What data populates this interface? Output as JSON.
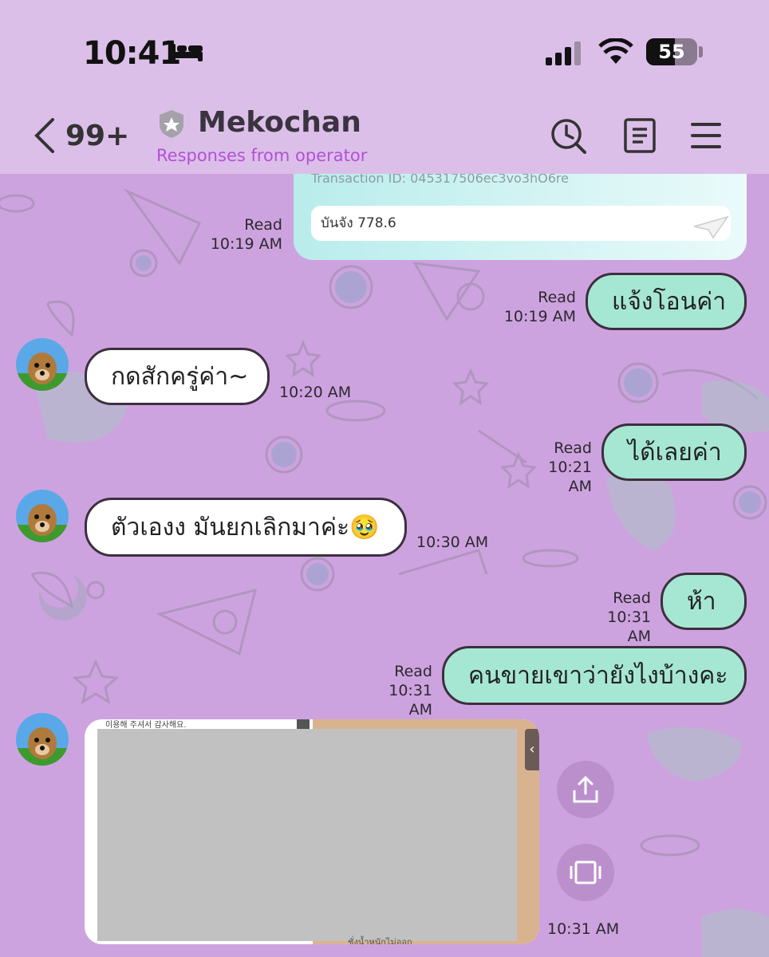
{
  "status_bar": {
    "time": "10:41",
    "battery": "55"
  },
  "header": {
    "back_count": "99+",
    "contact_name": "Mekochan",
    "subtitle": "Responses from operator"
  },
  "transfer": {
    "transaction_id": "Transaction ID: 045317506ec3vo3hO6re",
    "note": "บันจัง 778.6"
  },
  "messages": [
    {
      "side": "out",
      "status": "Read",
      "time": "10:19 AM",
      "text": ""
    },
    {
      "side": "out",
      "status": "Read",
      "time": "10:19 AM",
      "text": "แจ้งโอนค่า"
    },
    {
      "side": "in",
      "time": "10:20 AM",
      "text": "กดสักครู่ค่า~"
    },
    {
      "side": "out",
      "status": "Read",
      "time": "10:21 AM",
      "text": "ได้เลยค่า"
    },
    {
      "side": "in",
      "time": "10:30 AM",
      "text": "ตัวเองง มันยกเลิกมาค่ะ🥹"
    },
    {
      "side": "out",
      "status": "Read",
      "time": "10:31 AM",
      "text": "ห้า"
    },
    {
      "side": "out",
      "status": "Read",
      "time": "10:31 AM",
      "text": "คนขายเขาว่ายังไงบ้างคะ"
    },
    {
      "side": "in",
      "time": "10:31 AM",
      "text": ""
    }
  ],
  "preview": {
    "caption": "이용해 주셔서 감사해요.",
    "footer_text": "ชั่งน้ำหนักไม่ออก"
  },
  "icons": [
    "bed-icon",
    "signal-icon",
    "wifi-icon",
    "back-icon",
    "shield-icon",
    "clock-search-icon",
    "notes-icon",
    "menu-icon",
    "share-icon",
    "expand-icon"
  ],
  "colors": {
    "header": "#dcbfe8",
    "background": "#cda3df",
    "outgoing_bubble": "#a6e7d3",
    "incoming_bubble": "#ffffff",
    "subtitle": "#b44fd9"
  }
}
